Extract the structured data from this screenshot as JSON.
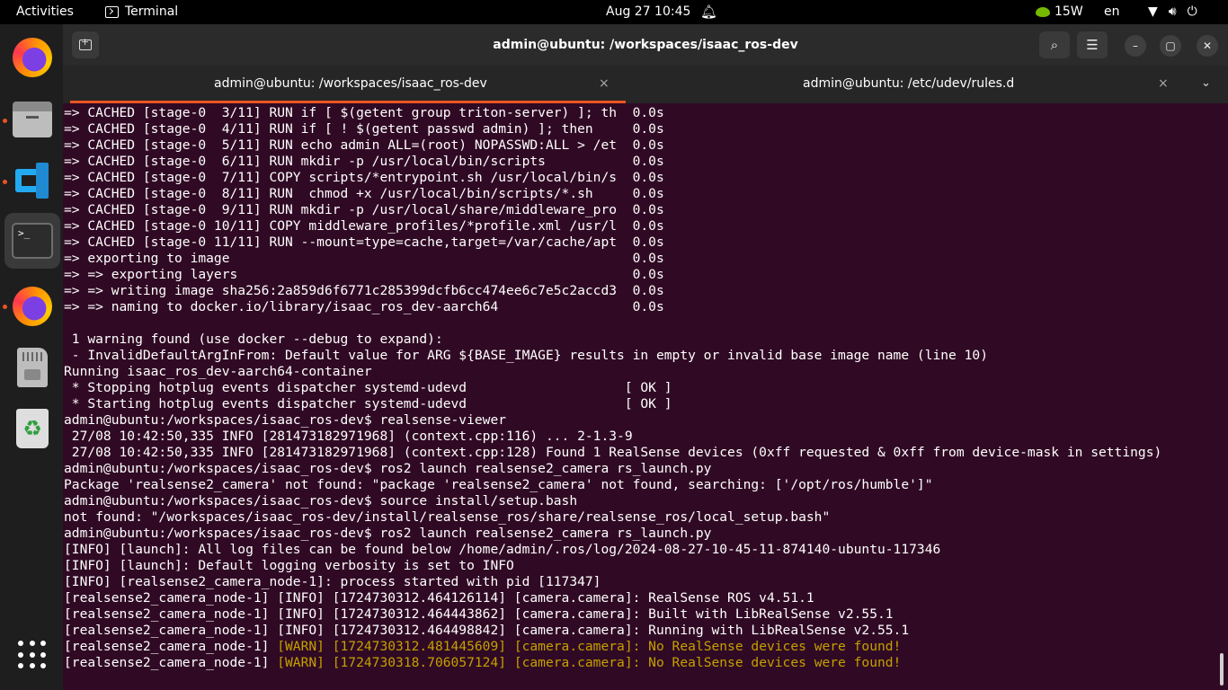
{
  "topbar": {
    "activities": "Activities",
    "app_name": "Terminal",
    "datetime": "Aug 27  10:45",
    "power": "15W",
    "language": "en"
  },
  "window": {
    "title": "admin@ubuntu: /workspaces/isaac_ros-dev",
    "tabs": [
      {
        "label": "admin@ubuntu: /workspaces/isaac_ros-dev",
        "close": "×"
      },
      {
        "label": "admin@ubuntu: /etc/udev/rules.d",
        "close": "×"
      }
    ]
  },
  "terminal": {
    "lines": [
      {
        "text": "=> CACHED [stage-0  3/11] RUN if [ $(getent group triton-server) ]; th  0.0s",
        "color": "blue"
      },
      {
        "text": "=> CACHED [stage-0  4/11] RUN if [ ! $(getent passwd admin) ]; then     0.0s",
        "color": "blue"
      },
      {
        "text": "=> CACHED [stage-0  5/11] RUN echo admin ALL=(root) NOPASSWD:ALL > /et  0.0s",
        "color": "blue"
      },
      {
        "text": "=> CACHED [stage-0  6/11] RUN mkdir -p /usr/local/bin/scripts           0.0s",
        "color": "blue"
      },
      {
        "text": "=> CACHED [stage-0  7/11] COPY scripts/*entrypoint.sh /usr/local/bin/s  0.0s",
        "color": "blue"
      },
      {
        "text": "=> CACHED [stage-0  8/11] RUN  chmod +x /usr/local/bin/scripts/*.sh     0.0s",
        "color": "blue"
      },
      {
        "text": "=> CACHED [stage-0  9/11] RUN mkdir -p /usr/local/share/middleware_pro  0.0s",
        "color": "blue"
      },
      {
        "text": "=> CACHED [stage-0 10/11] COPY middleware_profiles/*profile.xml /usr/l  0.0s",
        "color": "blue"
      },
      {
        "text": "=> CACHED [stage-0 11/11] RUN --mount=type=cache,target=/var/cache/apt  0.0s",
        "color": "blue"
      },
      {
        "text": "=> exporting to image                                                   0.0s",
        "color": "blue"
      },
      {
        "text": "=> => exporting layers                                                  0.0s",
        "color": "blue"
      },
      {
        "text": "=> => writing image sha256:2a859d6f6771c285399dcfb6cc474ee6c7e5c2accd3  0.0s",
        "color": "blue"
      },
      {
        "text": "=> => naming to docker.io/library/isaac_ros_dev-aarch64                 0.0s",
        "color": "blue"
      },
      {
        "text": "",
        "color": "white"
      },
      {
        "text": " 1 warning found (use docker --debug to expand):",
        "color": "warn"
      },
      {
        "text": " - InvalidDefaultArgInFrom: Default value for ARG ${BASE_IMAGE} results in empty or invalid base image name (line 10)",
        "color": "white"
      },
      {
        "text": "Running isaac_ros_dev-aarch64-container",
        "color": "green"
      },
      {
        "text": " * Stopping hotplug events dispatcher systemd-udevd                    [ OK ]",
        "color": "white"
      },
      {
        "text": " * Starting hotplug events dispatcher systemd-udevd                    [ OK ]",
        "color": "white"
      },
      {
        "text": "admin@ubuntu:/workspaces/isaac_ros-dev$ realsense-viewer",
        "color": "white"
      },
      {
        "text": " 27/08 10:42:50,335 INFO [281473182971968] (context.cpp:116) ... 2-1.3-9",
        "color": "white"
      },
      {
        "text": " 27/08 10:42:50,335 INFO [281473182971968] (context.cpp:128) Found 1 RealSense devices (0xff requested & 0xff from device-mask in settings)",
        "color": "white"
      },
      {
        "text": "admin@ubuntu:/workspaces/isaac_ros-dev$ ros2 launch realsense2_camera rs_launch.py",
        "color": "white"
      },
      {
        "text": "Package 'realsense2_camera' not found: \"package 'realsense2_camera' not found, searching: ['/opt/ros/humble']\"",
        "color": "white"
      },
      {
        "text": "admin@ubuntu:/workspaces/isaac_ros-dev$ source install/setup.bash",
        "color": "white"
      },
      {
        "text": "not found: \"/workspaces/isaac_ros-dev/install/realsense_ros/share/realsense_ros/local_setup.bash\"",
        "color": "white"
      },
      {
        "text": "admin@ubuntu:/workspaces/isaac_ros-dev$ ros2 launch realsense2_camera rs_launch.py",
        "color": "white"
      },
      {
        "text": "[INFO] [launch]: All log files can be found below /home/admin/.ros/log/2024-08-27-10-45-11-874140-ubuntu-117346",
        "color": "white"
      },
      {
        "text": "[INFO] [launch]: Default logging verbosity is set to INFO",
        "color": "white"
      },
      {
        "text": "[INFO] [realsense2_camera_node-1]: process started with pid [117347]",
        "color": "white"
      },
      {
        "text": "[realsense2_camera_node-1] [INFO] [1724730312.464126114] [camera.camera]: RealSense ROS v4.51.1",
        "color": "white"
      },
      {
        "text": "[realsense2_camera_node-1] [INFO] [1724730312.464443862] [camera.camera]: Built with LibRealSense v2.55.1",
        "color": "white"
      },
      {
        "text": "[realsense2_camera_node-1] [INFO] [1724730312.464498842] [camera.camera]: Running with LibRealSense v2.55.1",
        "color": "white"
      },
      {
        "text": "[realsense2_camera_node-1] ",
        "warn_text": "[WARN] [1724730312.481445609] [camera.camera]: No RealSense devices were found!",
        "color": "white"
      },
      {
        "text": "[realsense2_camera_node-1] ",
        "warn_text": "[WARN] [1724730318.706057124] [camera.camera]: No RealSense devices were found!",
        "color": "white"
      }
    ]
  },
  "dock": [
    {
      "name": "firefox-icon"
    },
    {
      "name": "files-icon"
    },
    {
      "name": "vscode-icon"
    },
    {
      "name": "terminal-icon",
      "glyph": ">_"
    },
    {
      "name": "firefox-icon-2"
    },
    {
      "name": "sd-card-icon"
    },
    {
      "name": "trash-icon",
      "glyph": "♻"
    },
    {
      "name": "show-apps-icon"
    }
  ],
  "colors": {
    "accent": "#e95420",
    "terminal_bg": "#300a24",
    "blue": "#3465a4",
    "warn": "#c4a000",
    "green": "#4e9a06"
  }
}
